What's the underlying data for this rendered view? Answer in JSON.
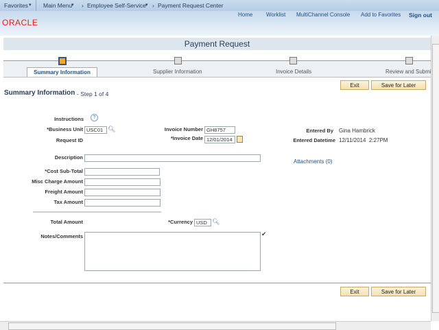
{
  "nav": {
    "favorites": "Favorites",
    "main_menu": "Main Menu",
    "ess": "Employee Self-Service",
    "current": "Payment Request Center"
  },
  "header_links": [
    "Home",
    "Worklist",
    "MultiChannel Console",
    "Add to Favorites",
    "Sign out"
  ],
  "logo": "ORACLE",
  "page_title": "Payment Request",
  "steps": [
    "Summary Information",
    "Supplier Information",
    "Invoice Details",
    "Review and Submit"
  ],
  "buttons": {
    "exit": "Exit",
    "save": "Save for Later"
  },
  "heading": "Summary Information",
  "step_text": "- Step 1 of 4",
  "form": {
    "instructions": "Instructions",
    "business_unit_label": "*Business Unit",
    "business_unit": "USC01",
    "request_id_label": "Request ID",
    "invoice_number_label": "Invoice Number",
    "invoice_number": "GH8757",
    "invoice_date_label": "*Invoice Date",
    "invoice_date": "12/01/2014",
    "entered_by_label": "Entered By",
    "entered_by": "Gina Hambrick",
    "entered_dt_label": "Entered Datetime",
    "entered_dt": "12/11/2014  2:27PM",
    "description_label": "Description",
    "attachments": "Attachments (0)",
    "cost_label": "*Cost Sub-Total",
    "misc_label": "Misc Charge Amount",
    "freight_label": "Freight Amount",
    "tax_label": "Tax Amount",
    "total_label": "Total Amount",
    "currency_label": "*Currency",
    "currency": "USD",
    "notes_label": "Notes/Comments"
  },
  "colors": {
    "accent": "#f5a623",
    "link": "#1f4f86"
  }
}
